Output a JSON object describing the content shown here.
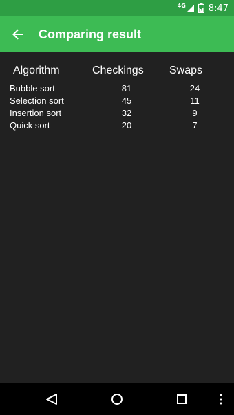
{
  "status_bar": {
    "network": "4G",
    "time": "8:47"
  },
  "app_bar": {
    "title": "Comparing result"
  },
  "table": {
    "headers": [
      "Algorithm",
      "Checkings",
      "Swaps"
    ],
    "rows": [
      {
        "algorithm": "Bubble sort",
        "checkings": "81",
        "swaps": "24"
      },
      {
        "algorithm": "Selection sort",
        "checkings": "45",
        "swaps": "11"
      },
      {
        "algorithm": "Insertion sort",
        "checkings": "32",
        "swaps": "9"
      },
      {
        "algorithm": "Quick sort",
        "checkings": "20",
        "swaps": "7"
      }
    ]
  },
  "colors": {
    "status_bar": "#2e9e44",
    "app_bar": "#3dbb54",
    "background": "#212121",
    "nav_bar": "#000000"
  },
  "icons": {
    "app_bar": [
      "arrow-back-icon"
    ],
    "nav_bar": [
      "nav-back-icon",
      "nav-home-icon",
      "nav-recents-icon",
      "overflow-menu-icon"
    ],
    "status_bar": [
      "signal-icon",
      "battery-icon"
    ]
  }
}
